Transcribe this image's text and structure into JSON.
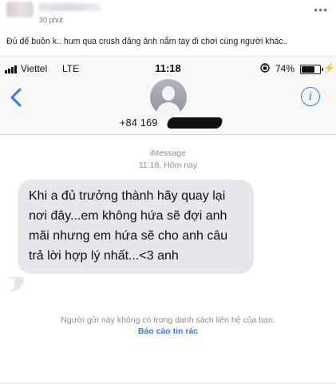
{
  "post": {
    "time": "30 phút",
    "more_icon": "ellipsis-icon",
    "caption": "Đủ để buồn k.. hum qua crush đăng ảnh nắm tay đi chơi cùng người khác.."
  },
  "status_bar": {
    "carrier": "Viettel",
    "network": "LTE",
    "time": "11:18",
    "battery_percent": "74%",
    "battery_level": 0.74,
    "charging_symbol": "⚡"
  },
  "nav": {
    "back_icon": "chevron-left-icon",
    "contact_number": "+84 169",
    "info_label": "i",
    "accent": "#2f7df6"
  },
  "thread": {
    "service_label": "iMessage",
    "timestamp": "11:18, Hôm nay",
    "messages": [
      {
        "from": "incoming",
        "text": "Khi a đủ trưởng thành hãy quay lại nơi đây...em không hứa sẽ đợi anh mãi nhưng em hứa sẽ cho anh câu trả lời hợp lý nhất...<3 anh"
      }
    ],
    "sender_notice": "Người gửi này không có trong danh sách liên hệ của bạn.",
    "report_label": "Báo cáo tin rác"
  }
}
